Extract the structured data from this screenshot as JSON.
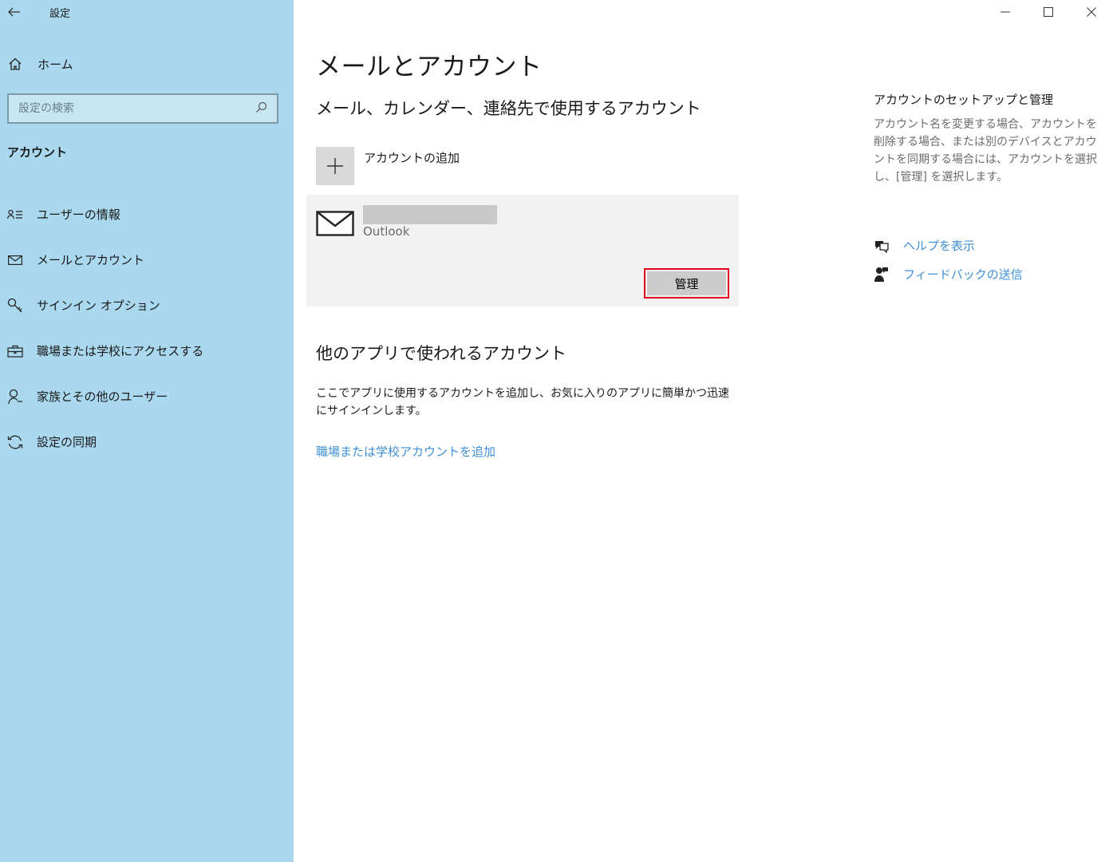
{
  "window": {
    "title": "設定",
    "controls": [
      "minimize-icon",
      "maximize-icon",
      "close-icon"
    ]
  },
  "sidebar": {
    "home_label": "ホーム",
    "search_placeholder": "設定の検索",
    "section_label": "アカウント",
    "items": [
      {
        "label": "ユーザーの情報",
        "icon": "user-info-icon"
      },
      {
        "label": "メールとアカウント",
        "icon": "mail-icon"
      },
      {
        "label": "サインイン オプション",
        "icon": "key-icon"
      },
      {
        "label": "職場または学校にアクセスする",
        "icon": "briefcase-icon"
      },
      {
        "label": "家族とその他のユーザー",
        "icon": "person-icon"
      },
      {
        "label": "設定の同期",
        "icon": "sync-icon"
      }
    ]
  },
  "main": {
    "title": "メールとアカウント",
    "subhead": "メール、カレンダー、連絡先で使用するアカウント",
    "add_account_label": "アカウントの追加",
    "account": {
      "provider": "Outlook",
      "manage_label": "管理"
    },
    "subhead2": "他のアプリで使われるアカウント",
    "description": "ここでアプリに使用するアカウントを追加し、お気に入りのアプリに簡単かつ迅速にサインインします。",
    "add_work_link": "職場または学校アカウントを追加"
  },
  "rail": {
    "title": "アカウントのセットアップと管理",
    "description": "アカウント名を変更する場合、アカウントを削除する場合、または別のデバイスとアカウントを同期する場合には、アカウントを選択し、[管理] を選択します。",
    "help_label": "ヘルプを表示",
    "feedback_label": "フィードバックの送信"
  },
  "colors": {
    "sidebar_bg": "#aad8ee",
    "link": "#3d8fd6",
    "highlight": "#e0001b"
  }
}
